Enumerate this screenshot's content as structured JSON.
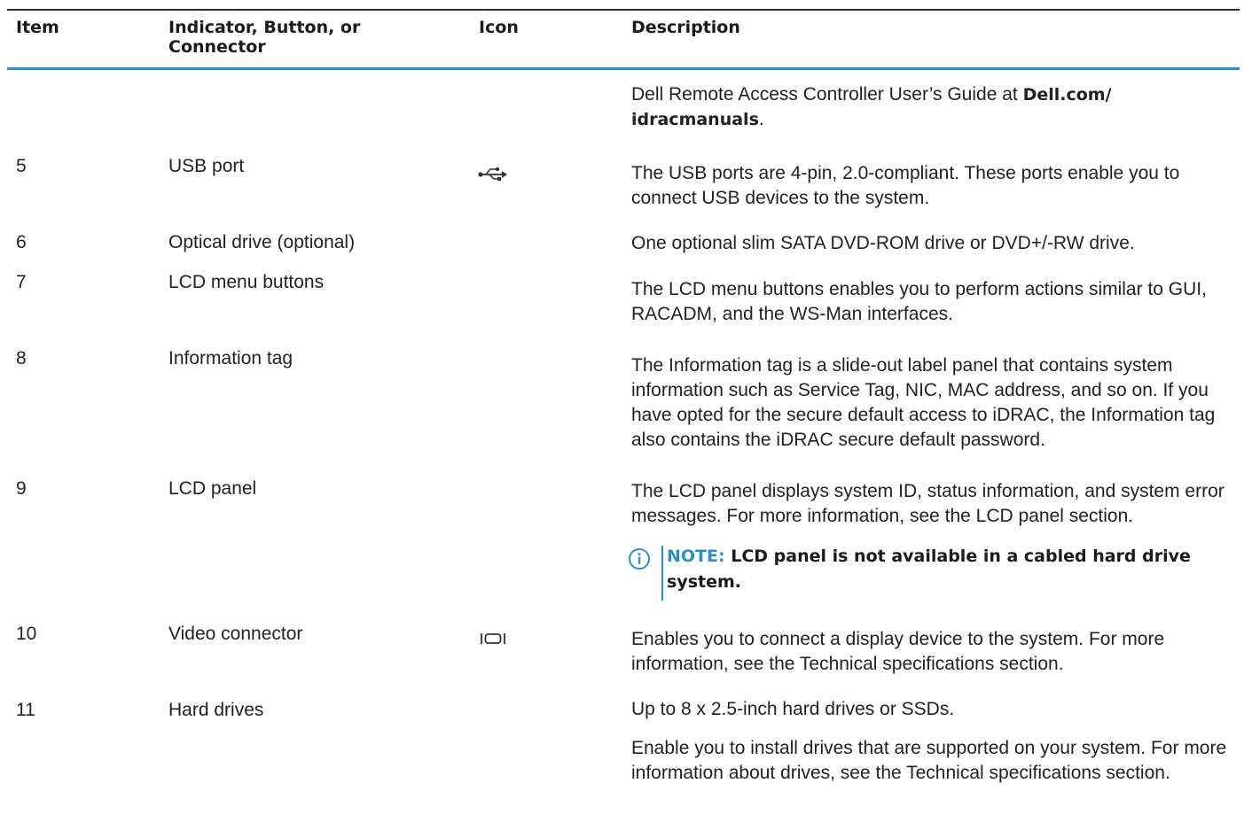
{
  "header": {
    "col_item": "Item",
    "col_indicator": "Indicator, Button, or Connector",
    "col_icon": "Icon",
    "col_description": "Description"
  },
  "continuation": {
    "text_before": "Dell Remote Access Controller User’s Guide at ",
    "link_text_1": "Dell.com/",
    "link_text_2": "idracmanuals",
    "text_after": "."
  },
  "rows": [
    {
      "item": "5",
      "name": "USB port",
      "icon": "usb-icon",
      "description": [
        "The USB ports are 4-pin, 2.0-compliant. These ports enable you to connect USB devices to the system."
      ]
    },
    {
      "item": "6",
      "name": "Optical drive (optional)",
      "icon": "",
      "description": [
        "One optional slim SATA DVD-ROM drive or DVD+/-RW drive."
      ]
    },
    {
      "item": "7",
      "name": "LCD menu buttons",
      "icon": "",
      "description": [
        "The LCD menu buttons enables you to perform actions similar to GUI, RACADM, and the WS-Man interfaces."
      ]
    },
    {
      "item": "8",
      "name": "Information tag",
      "icon": "",
      "description": [
        "The Information tag is a slide-out label panel that contains system information such as Service Tag, NIC, MAC address, and so on. If you have opted for the secure default access to iDRAC, the Information tag also contains the iDRAC secure default password."
      ]
    },
    {
      "item": "9",
      "name": "LCD panel",
      "icon": "",
      "description": [
        "The LCD panel displays system ID, status information, and system error messages. For more information, see the LCD panel section."
      ],
      "note": {
        "label": "NOTE:",
        "text": "LCD panel is not available in a cabled hard drive system."
      }
    },
    {
      "item": "10",
      "name": "Video connector",
      "icon": "video-connector-icon",
      "description": [
        "Enables you to connect a display device to the system. For more information, see the Technical specifications section."
      ]
    },
    {
      "item": "11",
      "name": "Hard drives",
      "icon": "",
      "description": [
        "Up to 8 x 2.5-inch hard drives or SSDs.",
        "Enable you to install drives that are supported on your system. For more information about drives, see the Technical specifications section."
      ]
    }
  ],
  "colors": {
    "accent": "#2d8fc9",
    "text": "#1b1b1b"
  }
}
